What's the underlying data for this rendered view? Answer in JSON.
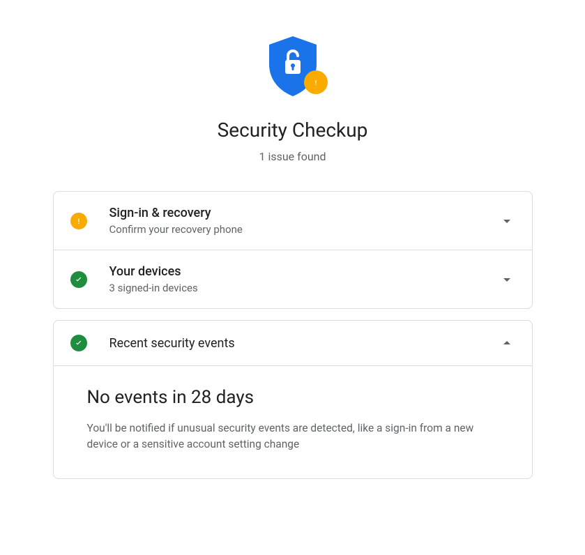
{
  "header": {
    "title": "Security Checkup",
    "subtitle": "1 issue found"
  },
  "sections": [
    {
      "status": "warn",
      "title": "Sign-in & recovery",
      "subtitle": "Confirm your recovery phone",
      "expanded": false
    },
    {
      "status": "ok",
      "title": "Your devices",
      "subtitle": "3 signed-in devices",
      "expanded": false
    }
  ],
  "events_section": {
    "status": "ok",
    "title": "Recent security events",
    "expanded": true,
    "panel": {
      "headline": "No events in 28 days",
      "description": "You'll be notified if unusual security events are detected, like a sign-in from a new device or a sensitive account setting change"
    }
  },
  "colors": {
    "warn": "#f9ab00",
    "ok": "#1e8e3e",
    "shield": "#1a73e8"
  }
}
